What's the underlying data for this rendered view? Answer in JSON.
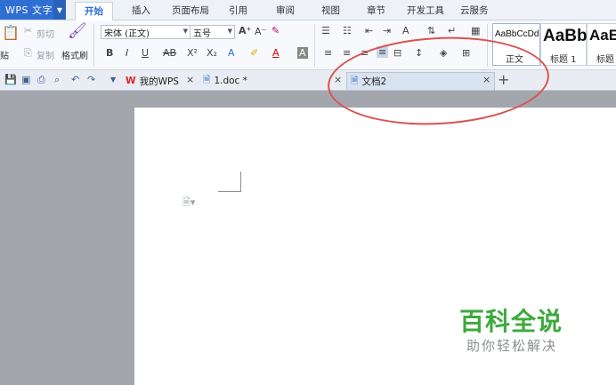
{
  "app": {
    "name": "WPS 文字"
  },
  "menu": {
    "tabs": [
      "开始",
      "插入",
      "页面布局",
      "引用",
      "审阅",
      "视图",
      "章节",
      "开发工具",
      "云服务"
    ]
  },
  "ribbon": {
    "clipboard": {
      "paste": "贴",
      "cut": "剪切",
      "copy": "复制",
      "format_painter": "格式刷"
    },
    "font": {
      "family": "宋体 (正文)",
      "size": "五号"
    },
    "styles": [
      {
        "sample": "AaBbCcDd",
        "name": "正文"
      },
      {
        "sample": "AaBb",
        "name": "标题 1"
      },
      {
        "sample": "AaE",
        "name": "标题"
      }
    ]
  },
  "tabs": {
    "items": [
      {
        "label": "我的WPS",
        "icon": "wps-logo-icon"
      },
      {
        "label": "1.doc *",
        "icon": "document-icon"
      },
      {
        "label": "文档2",
        "icon": "document-icon",
        "active": true
      }
    ]
  },
  "watermark": {
    "title": "百科全说",
    "subtitle": "助你轻松解决"
  },
  "colors": {
    "accent": "#2f6fd1",
    "annotation": "#d9534f",
    "watermark": "#3caa3c"
  }
}
